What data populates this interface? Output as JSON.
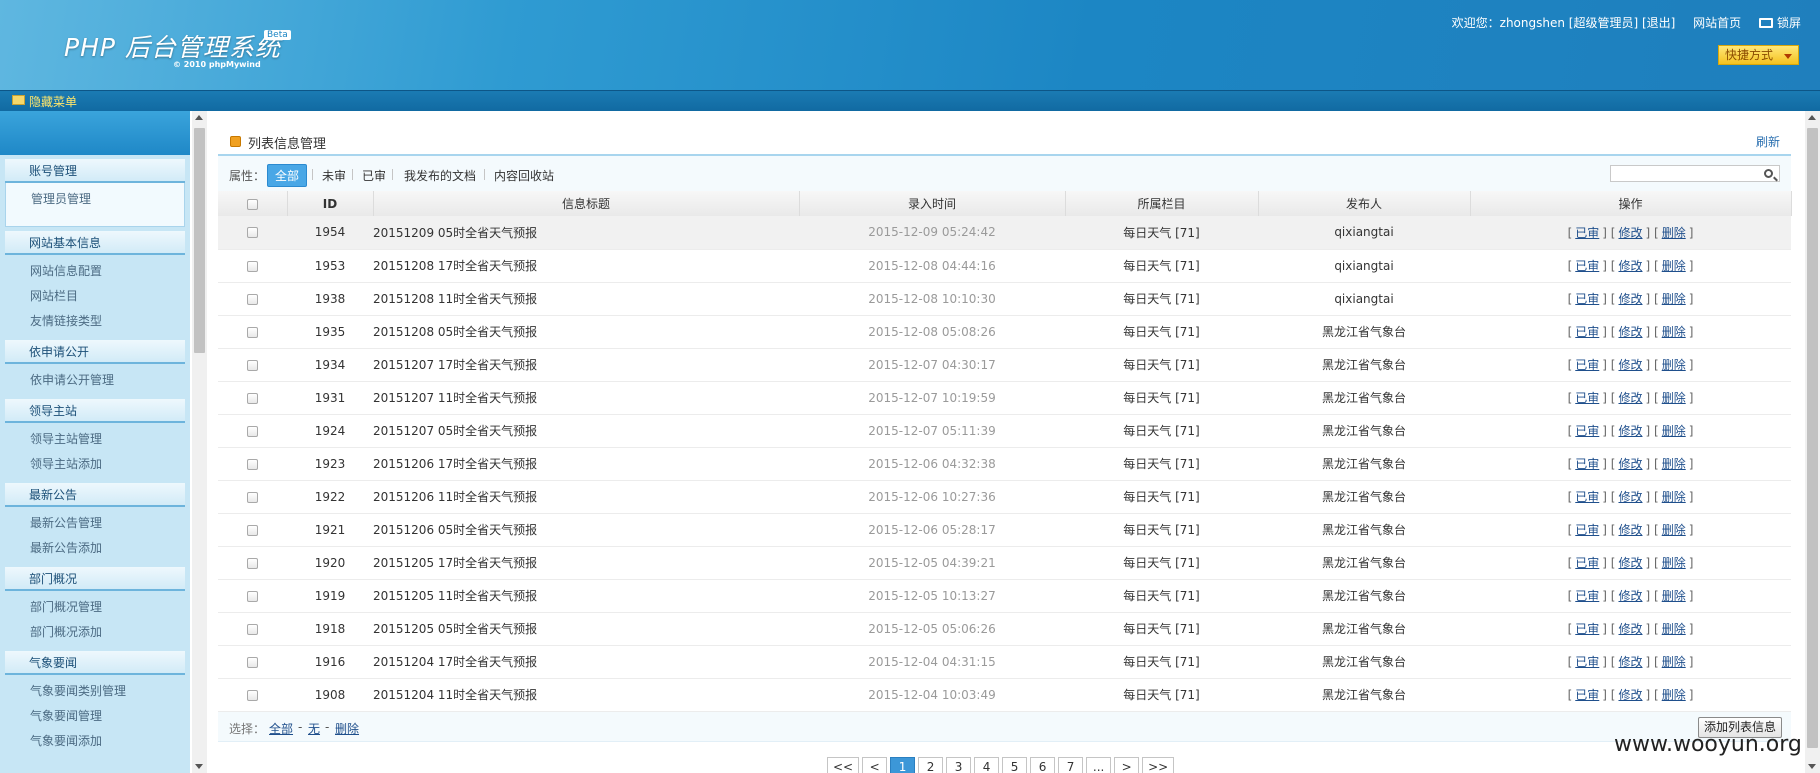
{
  "header": {
    "logo_text": "PHP 后台管理系统",
    "beta": "Beta",
    "copyright": "© 2010 phpMywind",
    "welcome": "欢迎您：zhongshen [超级管理员] [退出]",
    "home_link": "网站首页",
    "lock_link": "锁屏",
    "quick_menu": "快捷方式"
  },
  "menubar": {
    "hide_menu": "隐藏菜单"
  },
  "sidebar": {
    "groups": [
      {
        "title": "账号管理",
        "items": [
          "管理员管理"
        ]
      },
      {
        "title": "网站基本信息",
        "items": [
          "网站信息配置",
          "网站栏目",
          "友情链接类型"
        ]
      },
      {
        "title": "依申请公开",
        "items": [
          "依申请公开管理"
        ]
      },
      {
        "title": "领导主站",
        "items": [
          "领导主站管理",
          "领导主站添加"
        ]
      },
      {
        "title": "最新公告",
        "items": [
          "最新公告管理",
          "最新公告添加"
        ]
      },
      {
        "title": "部门概况",
        "items": [
          "部门概况管理",
          "部门概况添加"
        ]
      },
      {
        "title": "气象要闻",
        "items": [
          "气象要闻类别管理",
          "气象要闻管理",
          "气象要闻添加"
        ]
      }
    ]
  },
  "main": {
    "title": "列表信息管理",
    "refresh": "刷新",
    "filter_label": "属性：",
    "filters": [
      "全部",
      "未审",
      "已审",
      "我发布的文档",
      "内容回收站"
    ],
    "search_placeholder": "",
    "columns": [
      "ID",
      "信息标题",
      "录入时间",
      "所属栏目",
      "发布人",
      "操作"
    ],
    "ops": [
      "已审",
      "修改",
      "删除"
    ],
    "rows": [
      {
        "id": "1954",
        "title": "20151209 05时全省天气预报",
        "time": "2015-12-09 05:24:42",
        "column": "每日天气 [71]",
        "author": "qixiangtai"
      },
      {
        "id": "1953",
        "title": "20151208 17时全省天气预报",
        "time": "2015-12-08 04:44:16",
        "column": "每日天气 [71]",
        "author": "qixiangtai"
      },
      {
        "id": "1938",
        "title": "20151208 11时全省天气预报",
        "time": "2015-12-08 10:10:30",
        "column": "每日天气 [71]",
        "author": "qixiangtai"
      },
      {
        "id": "1935",
        "title": "20151208 05时全省天气预报",
        "time": "2015-12-08 05:08:26",
        "column": "每日天气 [71]",
        "author": "黑龙江省气象台"
      },
      {
        "id": "1934",
        "title": "20151207 17时全省天气预报",
        "time": "2015-12-07 04:30:17",
        "column": "每日天气 [71]",
        "author": "黑龙江省气象台"
      },
      {
        "id": "1931",
        "title": "20151207 11时全省天气预报",
        "time": "2015-12-07 10:19:59",
        "column": "每日天气 [71]",
        "author": "黑龙江省气象台"
      },
      {
        "id": "1924",
        "title": "20151207 05时全省天气预报",
        "time": "2015-12-07 05:11:39",
        "column": "每日天气 [71]",
        "author": "黑龙江省气象台"
      },
      {
        "id": "1923",
        "title": "20151206 17时全省天气预报",
        "time": "2015-12-06 04:32:38",
        "column": "每日天气 [71]",
        "author": "黑龙江省气象台"
      },
      {
        "id": "1922",
        "title": "20151206 11时全省天气预报",
        "time": "2015-12-06 10:27:36",
        "column": "每日天气 [71]",
        "author": "黑龙江省气象台"
      },
      {
        "id": "1921",
        "title": "20151206 05时全省天气预报",
        "time": "2015-12-06 05:28:17",
        "column": "每日天气 [71]",
        "author": "黑龙江省气象台"
      },
      {
        "id": "1920",
        "title": "20151205 17时全省天气预报",
        "time": "2015-12-05 04:39:21",
        "column": "每日天气 [71]",
        "author": "黑龙江省气象台"
      },
      {
        "id": "1919",
        "title": "20151205 11时全省天气预报",
        "time": "2015-12-05 10:13:27",
        "column": "每日天气 [71]",
        "author": "黑龙江省气象台"
      },
      {
        "id": "1918",
        "title": "20151205 05时全省天气预报",
        "time": "2015-12-05 05:06:26",
        "column": "每日天气 [71]",
        "author": "黑龙江省气象台"
      },
      {
        "id": "1916",
        "title": "20151204 17时全省天气预报",
        "time": "2015-12-04 04:31:15",
        "column": "每日天气 [71]",
        "author": "黑龙江省气象台"
      },
      {
        "id": "1908",
        "title": "20151204 11时全省天气预报",
        "time": "2015-12-04 10:03:49",
        "column": "每日天气 [71]",
        "author": "黑龙江省气象台"
      }
    ],
    "select_label": "选择：",
    "select_all": "全部",
    "select_none": "无",
    "select_delete": "删除",
    "add_button": "添加列表信息"
  },
  "pager": {
    "pages": [
      "<<",
      "<",
      "1",
      "2",
      "3",
      "4",
      "5",
      "6",
      "7",
      "...",
      ">",
      ">>"
    ],
    "current": "1"
  },
  "watermark": "www.wooyun.org",
  "colors": {
    "header_blue": "#1c86c4",
    "accent_blue": "#49a7e6",
    "quick_yellow": "#f5c220"
  }
}
